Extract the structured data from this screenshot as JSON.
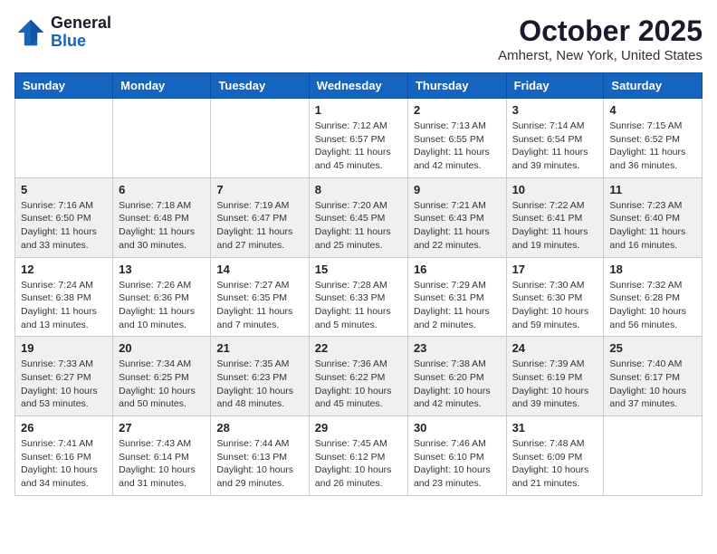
{
  "header": {
    "logo": {
      "line1": "General",
      "line2": "Blue"
    },
    "title": "October 2025",
    "subtitle": "Amherst, New York, United States"
  },
  "days_of_week": [
    "Sunday",
    "Monday",
    "Tuesday",
    "Wednesday",
    "Thursday",
    "Friday",
    "Saturday"
  ],
  "weeks": [
    [
      {
        "num": "",
        "info": ""
      },
      {
        "num": "",
        "info": ""
      },
      {
        "num": "",
        "info": ""
      },
      {
        "num": "1",
        "info": "Sunrise: 7:12 AM\nSunset: 6:57 PM\nDaylight: 11 hours and 45 minutes."
      },
      {
        "num": "2",
        "info": "Sunrise: 7:13 AM\nSunset: 6:55 PM\nDaylight: 11 hours and 42 minutes."
      },
      {
        "num": "3",
        "info": "Sunrise: 7:14 AM\nSunset: 6:54 PM\nDaylight: 11 hours and 39 minutes."
      },
      {
        "num": "4",
        "info": "Sunrise: 7:15 AM\nSunset: 6:52 PM\nDaylight: 11 hours and 36 minutes."
      }
    ],
    [
      {
        "num": "5",
        "info": "Sunrise: 7:16 AM\nSunset: 6:50 PM\nDaylight: 11 hours and 33 minutes."
      },
      {
        "num": "6",
        "info": "Sunrise: 7:18 AM\nSunset: 6:48 PM\nDaylight: 11 hours and 30 minutes."
      },
      {
        "num": "7",
        "info": "Sunrise: 7:19 AM\nSunset: 6:47 PM\nDaylight: 11 hours and 27 minutes."
      },
      {
        "num": "8",
        "info": "Sunrise: 7:20 AM\nSunset: 6:45 PM\nDaylight: 11 hours and 25 minutes."
      },
      {
        "num": "9",
        "info": "Sunrise: 7:21 AM\nSunset: 6:43 PM\nDaylight: 11 hours and 22 minutes."
      },
      {
        "num": "10",
        "info": "Sunrise: 7:22 AM\nSunset: 6:41 PM\nDaylight: 11 hours and 19 minutes."
      },
      {
        "num": "11",
        "info": "Sunrise: 7:23 AM\nSunset: 6:40 PM\nDaylight: 11 hours and 16 minutes."
      }
    ],
    [
      {
        "num": "12",
        "info": "Sunrise: 7:24 AM\nSunset: 6:38 PM\nDaylight: 11 hours and 13 minutes."
      },
      {
        "num": "13",
        "info": "Sunrise: 7:26 AM\nSunset: 6:36 PM\nDaylight: 11 hours and 10 minutes."
      },
      {
        "num": "14",
        "info": "Sunrise: 7:27 AM\nSunset: 6:35 PM\nDaylight: 11 hours and 7 minutes."
      },
      {
        "num": "15",
        "info": "Sunrise: 7:28 AM\nSunset: 6:33 PM\nDaylight: 11 hours and 5 minutes."
      },
      {
        "num": "16",
        "info": "Sunrise: 7:29 AM\nSunset: 6:31 PM\nDaylight: 11 hours and 2 minutes."
      },
      {
        "num": "17",
        "info": "Sunrise: 7:30 AM\nSunset: 6:30 PM\nDaylight: 10 hours and 59 minutes."
      },
      {
        "num": "18",
        "info": "Sunrise: 7:32 AM\nSunset: 6:28 PM\nDaylight: 10 hours and 56 minutes."
      }
    ],
    [
      {
        "num": "19",
        "info": "Sunrise: 7:33 AM\nSunset: 6:27 PM\nDaylight: 10 hours and 53 minutes."
      },
      {
        "num": "20",
        "info": "Sunrise: 7:34 AM\nSunset: 6:25 PM\nDaylight: 10 hours and 50 minutes."
      },
      {
        "num": "21",
        "info": "Sunrise: 7:35 AM\nSunset: 6:23 PM\nDaylight: 10 hours and 48 minutes."
      },
      {
        "num": "22",
        "info": "Sunrise: 7:36 AM\nSunset: 6:22 PM\nDaylight: 10 hours and 45 minutes."
      },
      {
        "num": "23",
        "info": "Sunrise: 7:38 AM\nSunset: 6:20 PM\nDaylight: 10 hours and 42 minutes."
      },
      {
        "num": "24",
        "info": "Sunrise: 7:39 AM\nSunset: 6:19 PM\nDaylight: 10 hours and 39 minutes."
      },
      {
        "num": "25",
        "info": "Sunrise: 7:40 AM\nSunset: 6:17 PM\nDaylight: 10 hours and 37 minutes."
      }
    ],
    [
      {
        "num": "26",
        "info": "Sunrise: 7:41 AM\nSunset: 6:16 PM\nDaylight: 10 hours and 34 minutes."
      },
      {
        "num": "27",
        "info": "Sunrise: 7:43 AM\nSunset: 6:14 PM\nDaylight: 10 hours and 31 minutes."
      },
      {
        "num": "28",
        "info": "Sunrise: 7:44 AM\nSunset: 6:13 PM\nDaylight: 10 hours and 29 minutes."
      },
      {
        "num": "29",
        "info": "Sunrise: 7:45 AM\nSunset: 6:12 PM\nDaylight: 10 hours and 26 minutes."
      },
      {
        "num": "30",
        "info": "Sunrise: 7:46 AM\nSunset: 6:10 PM\nDaylight: 10 hours and 23 minutes."
      },
      {
        "num": "31",
        "info": "Sunrise: 7:48 AM\nSunset: 6:09 PM\nDaylight: 10 hours and 21 minutes."
      },
      {
        "num": "",
        "info": ""
      }
    ]
  ]
}
